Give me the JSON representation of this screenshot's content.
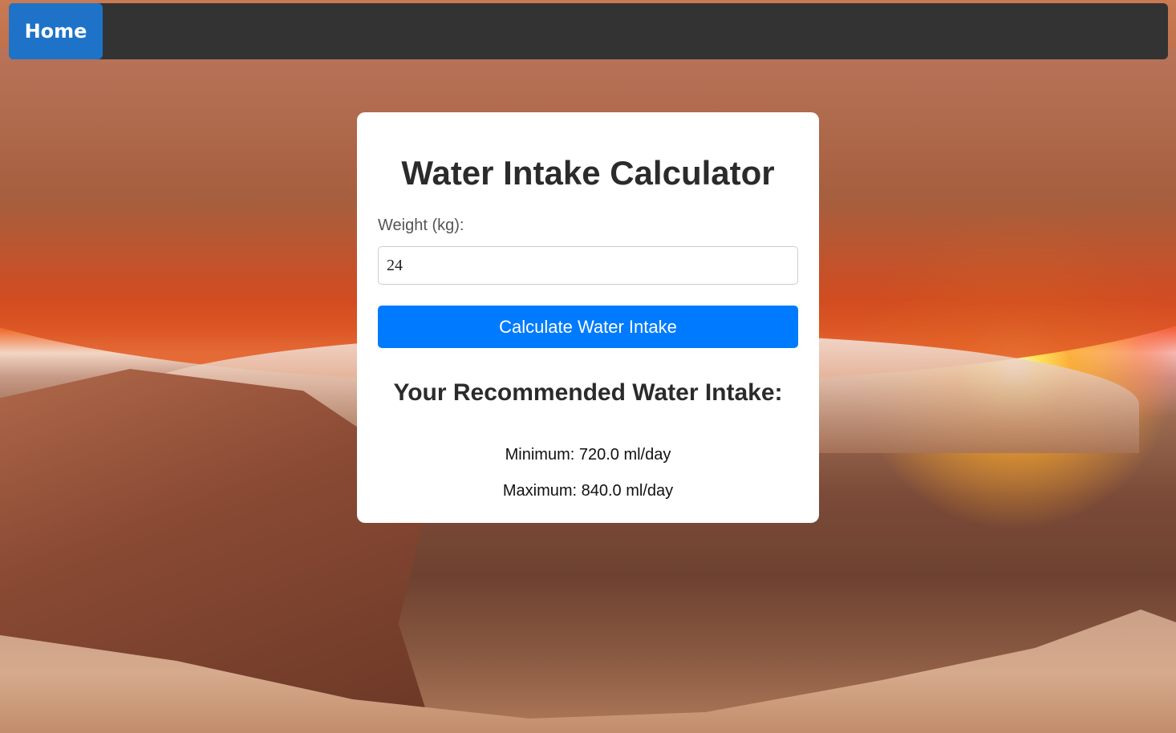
{
  "nav": {
    "home_label": "Home"
  },
  "calculator": {
    "title": "Water Intake Calculator",
    "weight_label": "Weight (kg):",
    "weight_value": "24",
    "button_label": "Calculate Water Intake"
  },
  "results": {
    "title": "Your Recommended Water Intake:",
    "minimum": "Minimum: 720.0 ml/day",
    "maximum": "Maximum: 840.0 ml/day"
  },
  "colors": {
    "nav_background": "#333333",
    "home_button": "#1e73c8",
    "primary_button": "#007bff",
    "card_background": "#ffffff"
  }
}
